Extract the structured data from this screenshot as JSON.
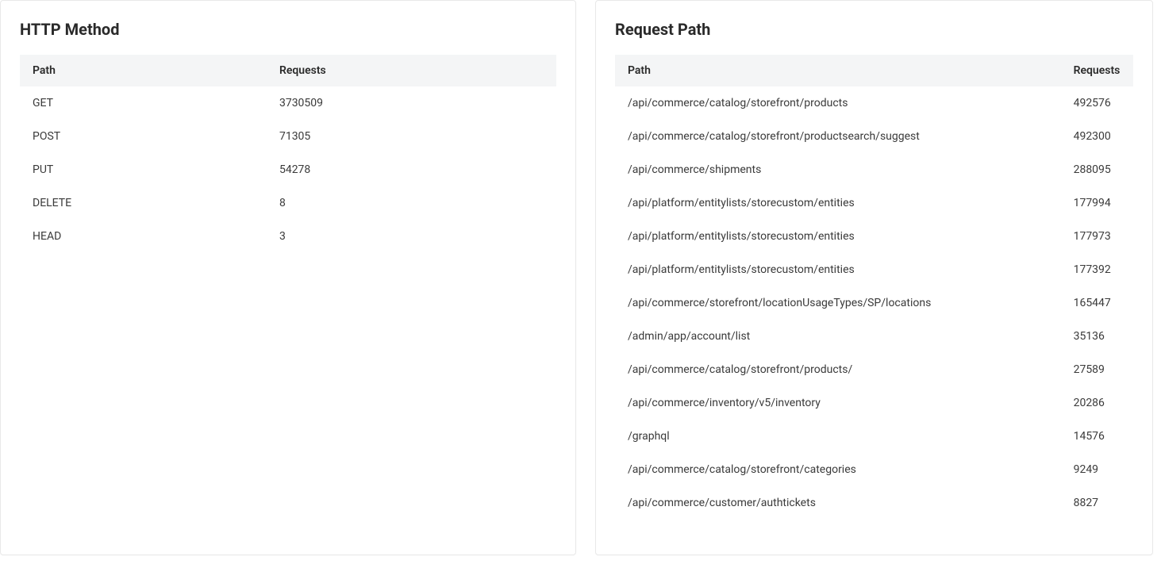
{
  "left": {
    "title": "HTTP Method",
    "columns": {
      "path": "Path",
      "requests": "Requests"
    },
    "rows": [
      {
        "path": "GET",
        "requests": "3730509"
      },
      {
        "path": "POST",
        "requests": "71305"
      },
      {
        "path": "PUT",
        "requests": "54278"
      },
      {
        "path": "DELETE",
        "requests": "8"
      },
      {
        "path": "HEAD",
        "requests": "3"
      }
    ]
  },
  "right": {
    "title": "Request Path",
    "columns": {
      "path": "Path",
      "requests": "Requests"
    },
    "rows": [
      {
        "path": "/api/commerce/catalog/storefront/products",
        "requests": "492576"
      },
      {
        "path": "/api/commerce/catalog/storefront/productsearch/suggest",
        "requests": "492300"
      },
      {
        "path": "/api/commerce/shipments",
        "requests": "288095"
      },
      {
        "path": "/api/platform/entitylists/storecustom/entities",
        "requests": "177994"
      },
      {
        "path": "/api/platform/entitylists/storecustom/entities",
        "requests": "177973"
      },
      {
        "path": "/api/platform/entitylists/storecustom/entities",
        "requests": "177392"
      },
      {
        "path": "/api/commerce/storefront/locationUsageTypes/SP/locations",
        "requests": "165447"
      },
      {
        "path": "/admin/app/account/list",
        "requests": "35136"
      },
      {
        "path": "/api/commerce/catalog/storefront/products/",
        "requests": "27589"
      },
      {
        "path": "/api/commerce/inventory/v5/inventory",
        "requests": "20286"
      },
      {
        "path": "/graphql",
        "requests": "14576"
      },
      {
        "path": "/api/commerce/catalog/storefront/categories",
        "requests": "9249"
      },
      {
        "path": "/api/commerce/customer/authtickets",
        "requests": "8827"
      }
    ]
  }
}
